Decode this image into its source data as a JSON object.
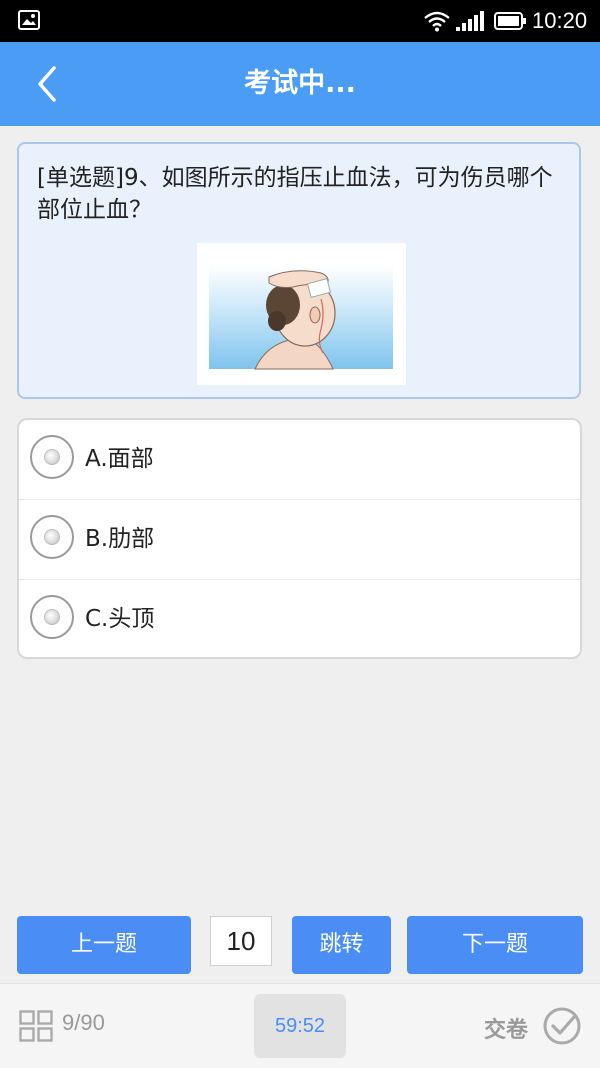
{
  "status_bar": {
    "time": "10:20",
    "icons": [
      "image-notification-icon",
      "wifi-icon",
      "signal-icon",
      "battery-icon"
    ]
  },
  "header": {
    "title": "考试中...",
    "back_icon": "back-arrow-icon"
  },
  "question": {
    "text": "[单选题]9、如图所示的指压止血法，可为伤员哪个部位止血？",
    "image": "head-pressure-illustration"
  },
  "options": [
    {
      "label": "A.面部"
    },
    {
      "label": "B.肋部"
    },
    {
      "label": "C.头顶"
    }
  ],
  "navigation": {
    "prev_label": "上一题",
    "jump_value": "10",
    "jump_label": "跳转",
    "next_label": "下一题"
  },
  "bottom_bar": {
    "progress": "9/90",
    "timer": "59:52",
    "submit_label": "交卷"
  },
  "colors": {
    "primary": "#4a9cf5",
    "button": "#4a8ef5",
    "card_bg": "#e9f1fc"
  }
}
